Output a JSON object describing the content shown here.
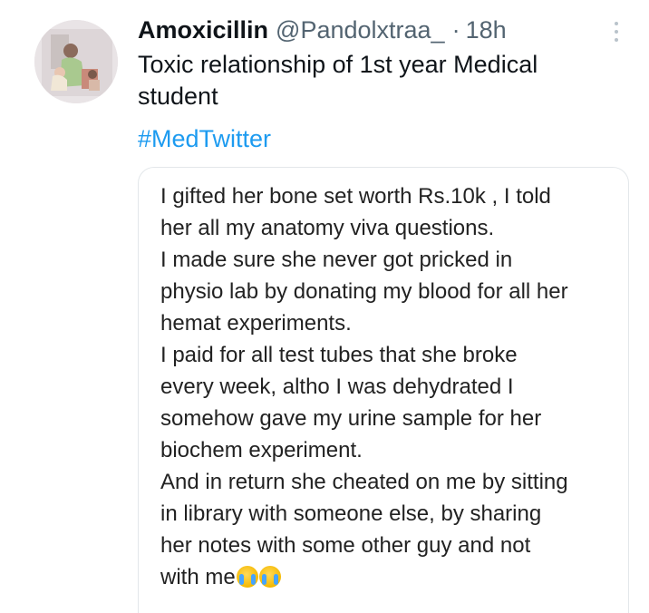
{
  "tweet": {
    "display_name": "Amoxicillin",
    "handle": "@Pandolxtraa_",
    "separator": "·",
    "time": "18h",
    "text_lines": [
      "Toxic relationship of 1st year Medical",
      "student"
    ],
    "hashtag": "#MedTwitter",
    "more_icon": "more-vertical-icon",
    "avatar_icon": "profile-photo"
  },
  "quoted_image": {
    "lines": [
      "I gifted her bone set worth Rs.10k , I told",
      "her all my anatomy viva questions.",
      "I made sure she never got pricked in",
      "physio lab by donating my blood for all her",
      "hemat experiments.",
      "I paid for all test tubes that she broke",
      "every week, altho I was dehydrated I",
      "somehow gave my urine sample for her",
      "biochem experiment.",
      "And in return she cheated on me by sitting",
      "in library with someone else, by sharing",
      "her notes with some other guy and not",
      "with me"
    ],
    "trailing_emoji": "loudly-crying-face-icon"
  },
  "colors": {
    "text": "#0f1419",
    "muted": "#536471",
    "link": "#1d9bf0",
    "card_border": "#e3e7ea"
  }
}
